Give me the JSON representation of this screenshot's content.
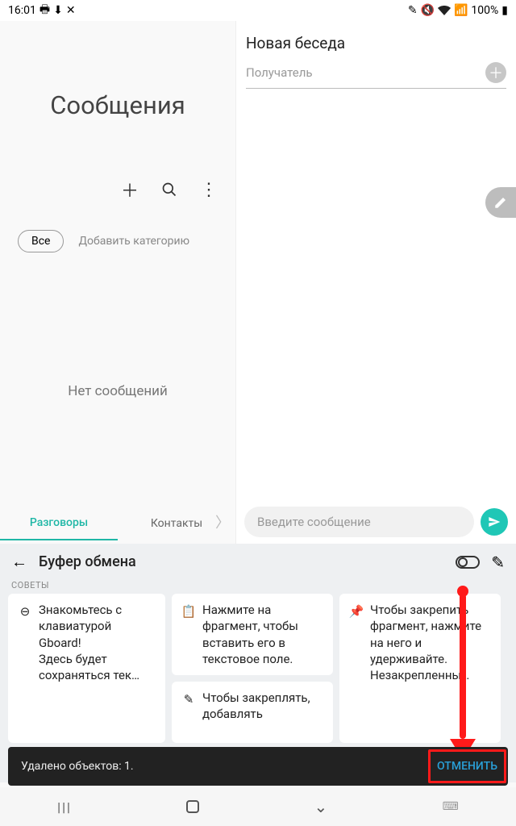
{
  "status": {
    "time": "16:01",
    "battery": "100%"
  },
  "left": {
    "title": "Сообщения",
    "chip_all": "Все",
    "chip_add": "Добавить категорию",
    "empty": "Нет сообщений",
    "tab_conv": "Разговоры",
    "tab_cont": "Контакты"
  },
  "right": {
    "title": "Новая беседа",
    "recipient_ph": "Получатель",
    "input_ph": "Введите сообщение"
  },
  "clipboard": {
    "title": "Буфер обмена",
    "tips_label": "СОВЕТЫ",
    "tips": [
      "Знакомьтесь с клавиатурой Gboard!\nЗдесь будет сохраняться тек…",
      "Нажмите на фрагмент, чтобы вставить его в текстовое поле.",
      "Чтобы закреплять, добавлять",
      "Чтобы закрепить фрагмент, нажмите на него и удерживайте. Незакрепленны…"
    ]
  },
  "snackbar": {
    "text": "Удалено объектов: 1.",
    "action": "ОТМЕНИТЬ"
  }
}
